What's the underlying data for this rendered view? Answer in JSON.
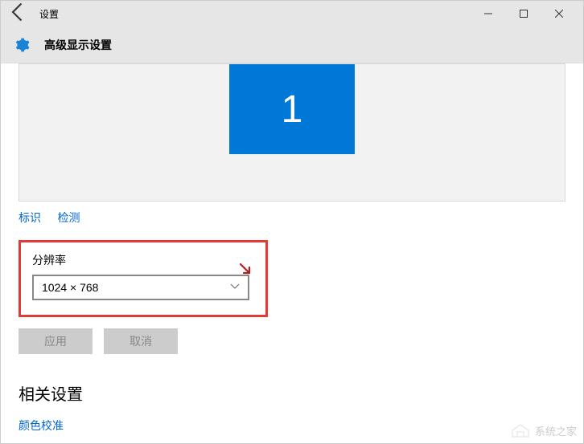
{
  "titlebar": {
    "title": "设置"
  },
  "header": {
    "label": "高级显示设置"
  },
  "monitor": {
    "number": "1"
  },
  "links": {
    "identify": "标识",
    "detect": "检测"
  },
  "resolution": {
    "label": "分辨率",
    "value": "1024 × 768"
  },
  "buttons": {
    "apply": "应用",
    "cancel": "取消"
  },
  "related": {
    "heading": "相关设置",
    "color_calibration": "颜色校准"
  },
  "watermark": {
    "text": "系统之家"
  }
}
